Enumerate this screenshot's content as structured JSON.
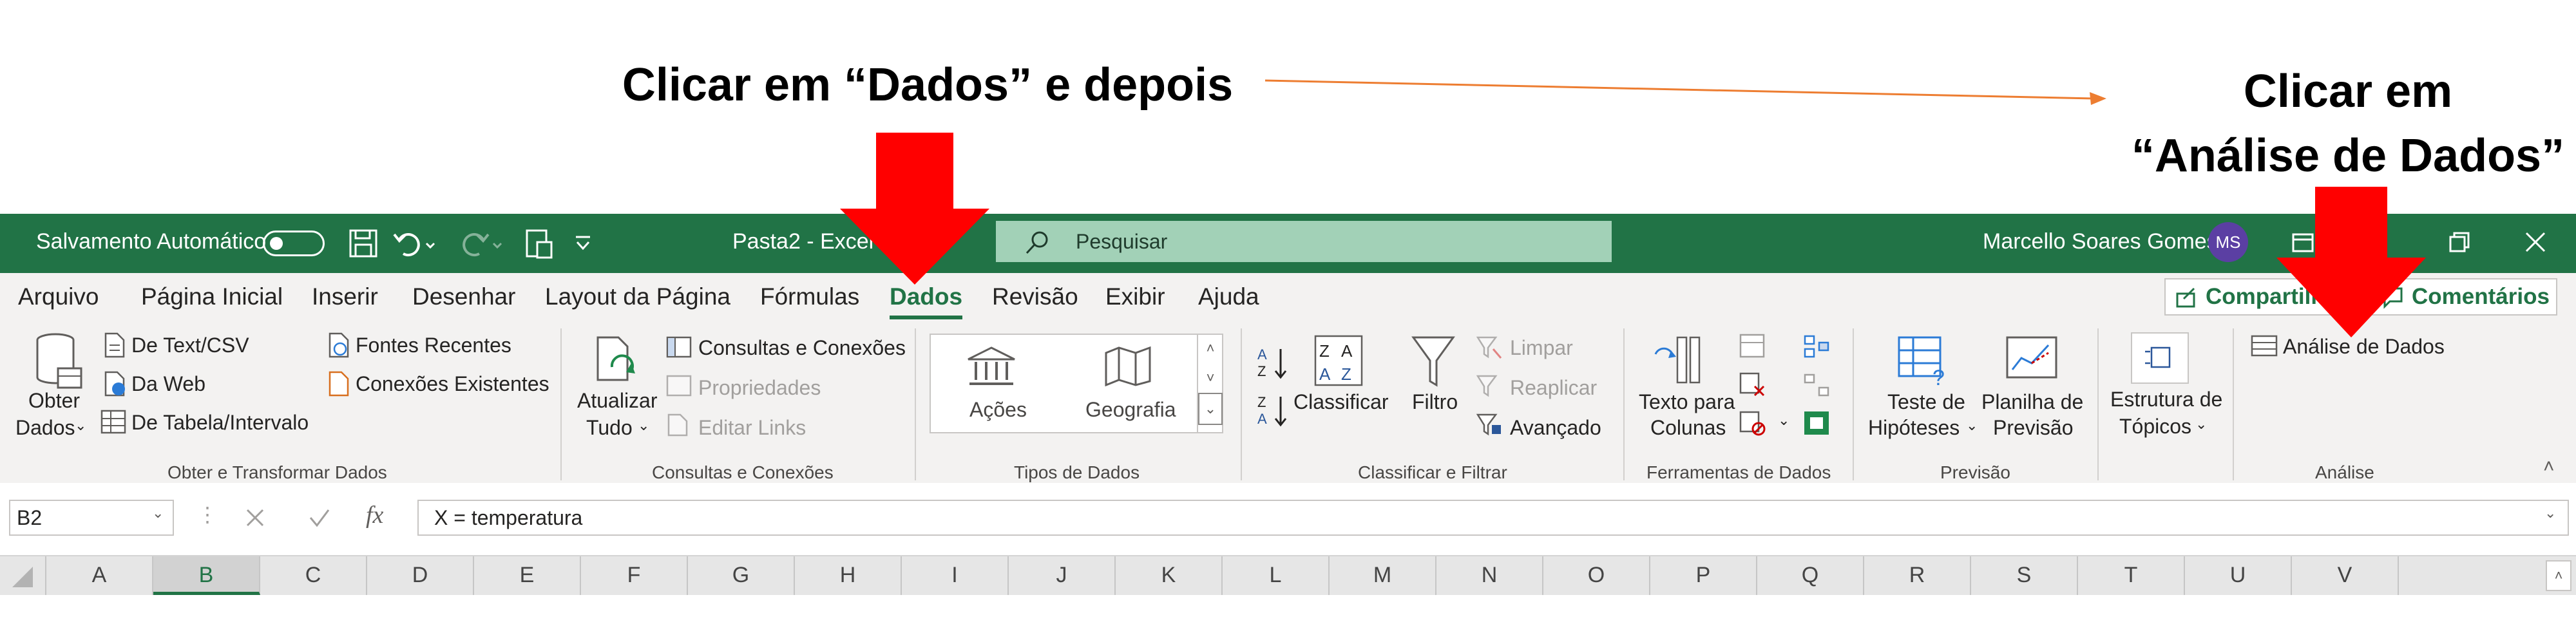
{
  "annotations": {
    "instruction_left": "Clicar em “Dados” e depois",
    "instruction_right_line1": "Clicar em",
    "instruction_right_line2": "“Análise de Dados”"
  },
  "titlebar": {
    "autosave_label": "Salvamento Automático",
    "document_title": "Pasta2  -  Excel",
    "search_placeholder": "Pesquisar",
    "user_name": "Marcello Soares Gomes",
    "user_initials": "MS"
  },
  "tabs": [
    "Arquivo",
    "Página Inicial",
    "Inserir",
    "Desenhar",
    "Layout da Página",
    "Fórmulas",
    "Dados",
    "Revisão",
    "Exibir",
    "Ajuda"
  ],
  "active_tab": "Dados",
  "share_label": "Compartilhar",
  "comments_label": "Comentários",
  "ribbon": {
    "get_data": {
      "obter": "Obter",
      "dados": "Dados",
      "text_csv": "De Text/CSV",
      "web": "Da Web",
      "table": "De Tabela/Intervalo",
      "recent": "Fontes Recentes",
      "existing": "Conexões Existentes",
      "group": "Obter e Transformar Dados"
    },
    "queries": {
      "refresh1": "Atualizar",
      "refresh2": "Tudo",
      "queries_conn": "Consultas e Conexões",
      "properties": "Propriedades",
      "edit_links": "Editar Links",
      "group": "Consultas e Conexões"
    },
    "data_types": {
      "stocks": "Ações",
      "geography": "Geografia",
      "group": "Tipos de Dados"
    },
    "sort_filter": {
      "sort": "Classificar",
      "filter": "Filtro",
      "clear": "Limpar",
      "reapply": "Reaplicar",
      "advanced": "Avançado",
      "group": "Classificar e Filtrar"
    },
    "data_tools": {
      "text_to_cols1": "Texto para",
      "text_to_cols2": "Colunas",
      "group": "Ferramentas de Dados"
    },
    "forecast": {
      "whatif1": "Teste de",
      "whatif2": "Hipóteses",
      "sheet1": "Planilha de",
      "sheet2": "Previsão",
      "group": "Previsão"
    },
    "outline": {
      "label1": "Estrutura de",
      "label2": "Tópicos",
      "group": ""
    },
    "analysis": {
      "data_analysis": "Análise de Dados",
      "group": "Análise"
    }
  },
  "formula_bar": {
    "name_box": "B2",
    "formula": "X = temperatura"
  },
  "columns": [
    "A",
    "B",
    "C",
    "D",
    "E",
    "F",
    "G",
    "H",
    "I",
    "J",
    "K",
    "L",
    "M",
    "N",
    "O",
    "P",
    "Q",
    "R",
    "S",
    "T",
    "U",
    "V"
  ],
  "selected_column": "B",
  "colors": {
    "excel_green": "#217346",
    "arrow_red": "#ff0000",
    "line_orange": "#ed7d31"
  }
}
